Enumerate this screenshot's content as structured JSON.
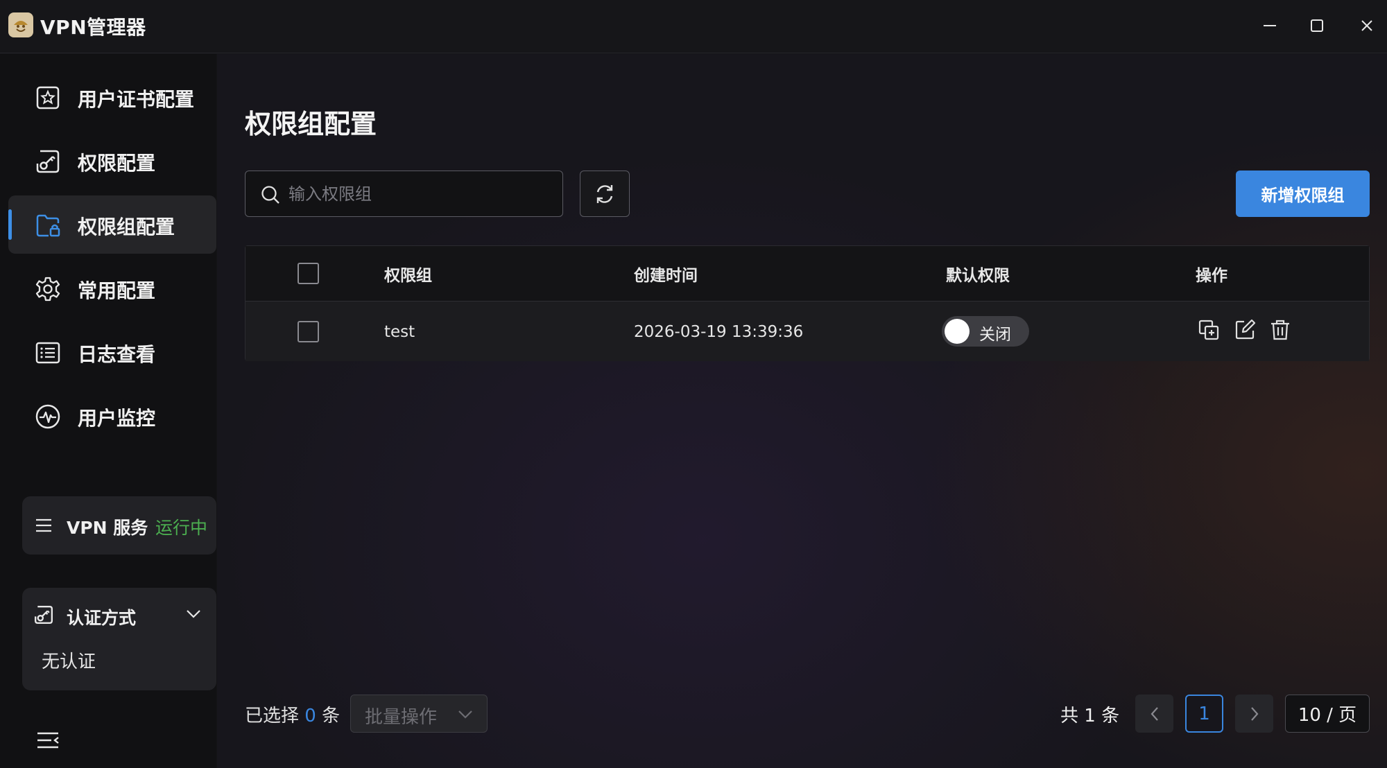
{
  "app": {
    "title": "VPN管理器"
  },
  "sidebar": {
    "items": [
      {
        "label": "用户证书配置",
        "icon": "certificate-icon"
      },
      {
        "label": "权限配置",
        "icon": "key-icon"
      },
      {
        "label": "权限组配置",
        "icon": "folder-lock-icon",
        "active": true
      },
      {
        "label": "常用配置",
        "icon": "gear-icon"
      },
      {
        "label": "日志查看",
        "icon": "list-icon"
      },
      {
        "label": "用户监控",
        "icon": "pulse-icon"
      }
    ],
    "vpn_service": {
      "label": "VPN 服务",
      "status": "运行中",
      "status_color": "#4caf50"
    },
    "auth": {
      "label": "认证方式",
      "value": "无认证"
    }
  },
  "main": {
    "title": "权限组配置",
    "search": {
      "placeholder": "输入权限组",
      "value": ""
    },
    "add_button": "新增权限组",
    "table": {
      "columns": [
        "权限组",
        "创建时间",
        "默认权限",
        "操作"
      ],
      "rows": [
        {
          "group": "test",
          "created": "2026-03-19 13:39:36",
          "default_perm": "关闭",
          "default_on": false
        }
      ]
    },
    "footer": {
      "selected_prefix": "已选择",
      "selected_count": "0",
      "selected_suffix": "条",
      "batch_label": "批量操作",
      "total": "共 1 条",
      "current_page": "1",
      "page_size": "10 / 页"
    }
  },
  "colors": {
    "accent": "#3a86df",
    "success": "#4caf50"
  }
}
